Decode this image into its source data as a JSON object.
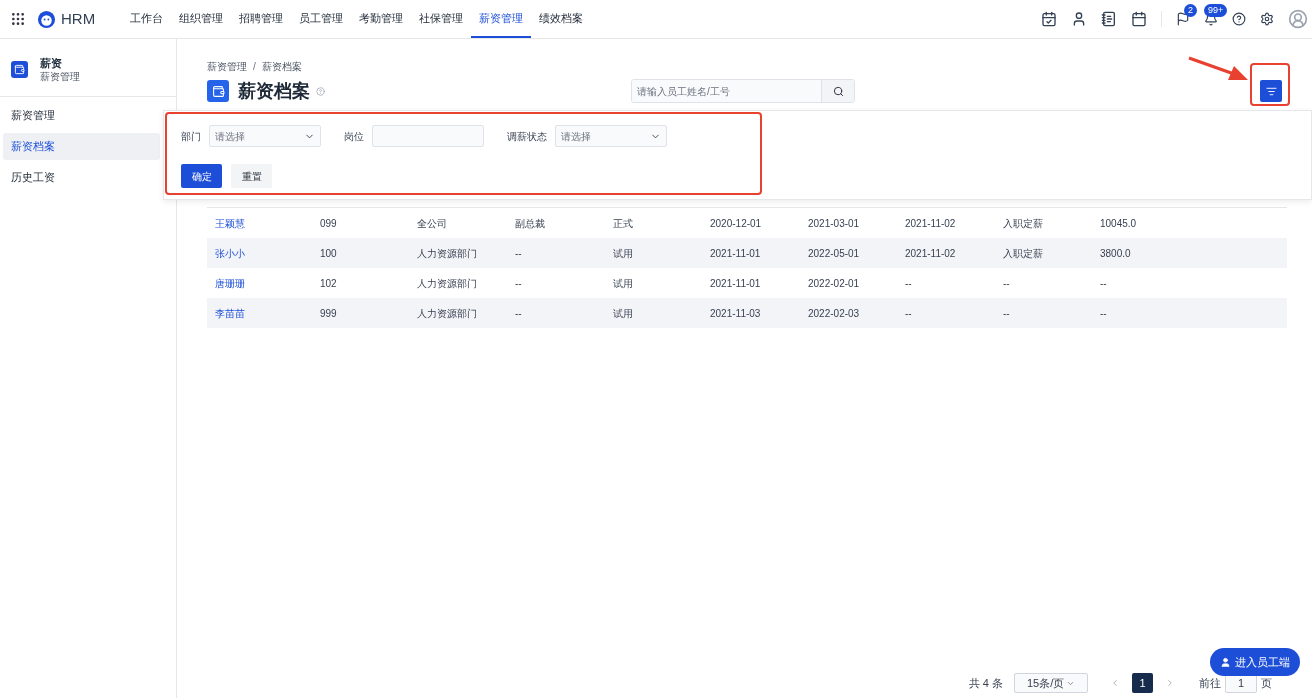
{
  "brand": "HRM",
  "nav": [
    {
      "label": "工作台",
      "selected": false
    },
    {
      "label": "组织管理",
      "selected": false
    },
    {
      "label": "招聘管理",
      "selected": false
    },
    {
      "label": "员工管理",
      "selected": false
    },
    {
      "label": "考勤管理",
      "selected": false
    },
    {
      "label": "社保管理",
      "selected": false
    },
    {
      "label": "薪资管理",
      "selected": true
    },
    {
      "label": "绩效档案",
      "selected": false
    }
  ],
  "toolbar": {
    "flag_badge": "2",
    "bell_badge": "99+"
  },
  "sidebar": {
    "title": "薪资",
    "subtitle": "薪资管理",
    "items": [
      {
        "label": "薪资管理",
        "selected": false
      },
      {
        "label": "薪资档案",
        "selected": true
      },
      {
        "label": "历史工资",
        "selected": false
      }
    ]
  },
  "breadcrumb": {
    "items": [
      "薪资管理",
      "薪资档案"
    ],
    "separator": "/"
  },
  "page_title": "薪资档案",
  "search": {
    "placeholder": "请输入员工姓名/工号"
  },
  "filter": {
    "fields": [
      {
        "kind": "select",
        "label": "部门",
        "placeholder": "请选择"
      },
      {
        "kind": "input",
        "label": "岗位"
      },
      {
        "kind": "select",
        "label": "调薪状态",
        "placeholder": "请选择"
      }
    ],
    "buttons": [
      {
        "label": "确定",
        "kind": "primary"
      },
      {
        "label": "重置",
        "kind": "secondary"
      }
    ]
  },
  "table": {
    "rows": [
      [
        "王颖慧",
        "099",
        "全公司",
        "副总裁",
        "正式",
        "2020-12-01",
        "2021-03-01",
        "2021-11-02",
        "入职定薪",
        "10045.0"
      ],
      [
        "张小小",
        "100",
        "人力资源部门",
        "--",
        "试用",
        "2021-11-01",
        "2022-05-01",
        "2021-11-02",
        "入职定薪",
        "3800.0"
      ],
      [
        "唐珊珊",
        "102",
        "人力资源部门",
        "--",
        "试用",
        "2021-11-01",
        "2022-02-01",
        "--",
        "--",
        "--"
      ],
      [
        "李苗苗",
        "999",
        "人力资源部门",
        "--",
        "试用",
        "2021-11-03",
        "2022-02-03",
        "--",
        "--",
        "--"
      ]
    ]
  },
  "pagination": {
    "total": "共 4 条",
    "page_size": "15条/页",
    "pages": [
      {
        "label": "1",
        "selected": true
      }
    ],
    "goto_label": "前往",
    "goto_value": "1",
    "goto_suffix": "页"
  },
  "float_button": "进入员工端"
}
